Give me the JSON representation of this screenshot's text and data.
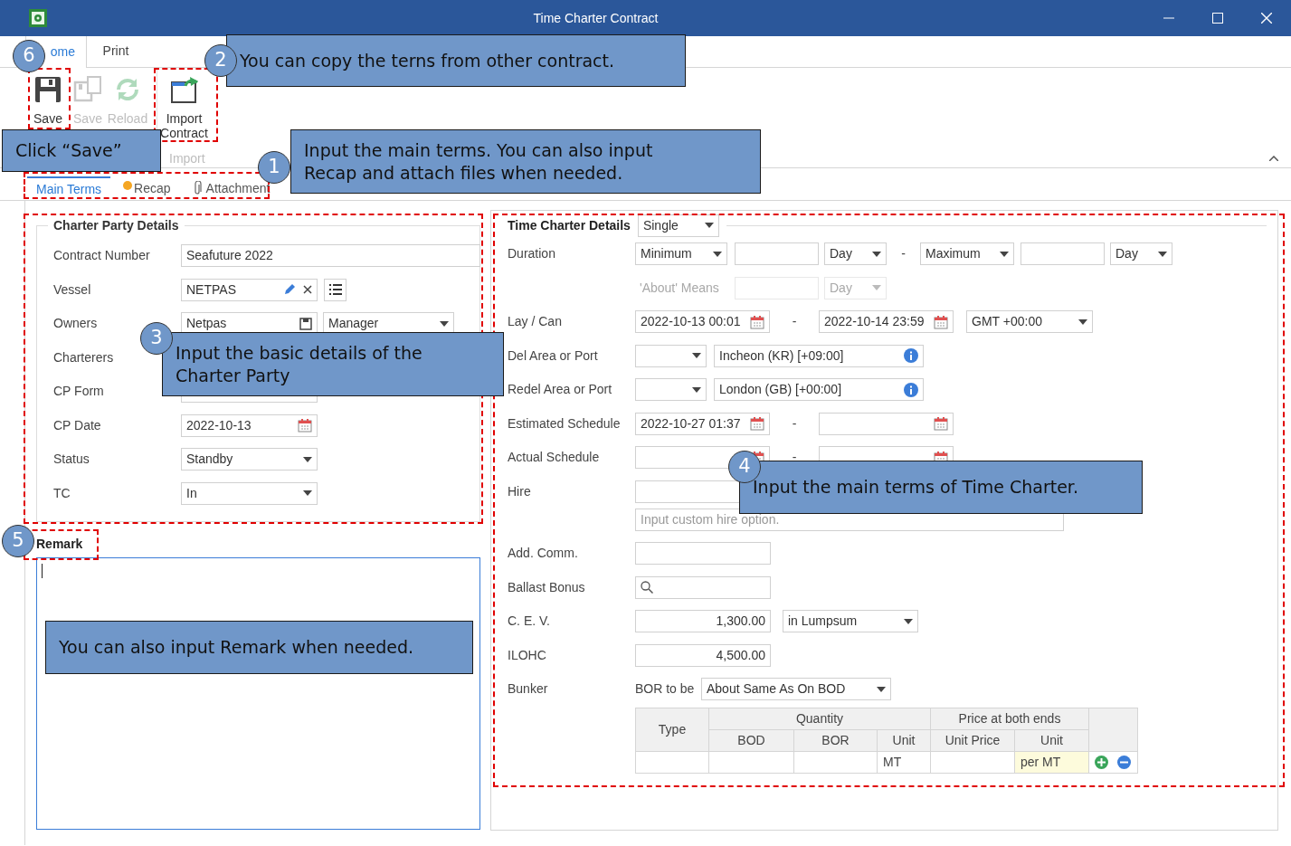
{
  "window": {
    "title": "Time Charter Contract"
  },
  "ribbon": {
    "tabs": [
      {
        "label": "ome",
        "selected": true
      },
      {
        "label": "Print",
        "selected": false
      }
    ],
    "buttons": [
      {
        "label": "Save",
        "kind": "save",
        "disabled": false
      },
      {
        "label": "Save",
        "kind": "save_all",
        "disabled": true
      },
      {
        "label": "Reload",
        "kind": "reload",
        "disabled": true
      },
      {
        "label": "Import Contract",
        "kind": "import",
        "disabled": false
      }
    ],
    "group_label": "Import"
  },
  "content_tabs": [
    {
      "label": "Main Terms",
      "kind": "plain",
      "selected": true
    },
    {
      "label": "Recap",
      "kind": "dot",
      "selected": false
    },
    {
      "label": "Attachment",
      "kind": "clip",
      "selected": false
    }
  ],
  "charter_party": {
    "title": "Charter Party Details",
    "rows": [
      {
        "label": "Contract Number",
        "kind": "wide_text",
        "value": "Seafuture 2022"
      },
      {
        "label": "Vessel",
        "kind": "vessel",
        "value": "NETPAS"
      },
      {
        "label": "Owners",
        "kind": "owners",
        "value": "Netpas",
        "role": "Manager"
      },
      {
        "label": "Charterers",
        "kind": "label_only"
      },
      {
        "label": "CP Form",
        "kind": "covered_text"
      },
      {
        "label": "CP Date",
        "kind": "date",
        "value": "2022-10-13"
      },
      {
        "label": "Status",
        "kind": "select",
        "value": "Standby"
      },
      {
        "label": "TC",
        "kind": "select",
        "value": "In"
      }
    ]
  },
  "remark": {
    "label": "Remark"
  },
  "time_charter": {
    "title": "Time Charter Details",
    "mode": "Single",
    "rows": [
      {
        "label": "Duration",
        "kind": "duration",
        "min_select": "Minimum",
        "min_unit": "Day",
        "separator": "-",
        "max_select": "Maximum",
        "max_unit": "Day"
      },
      {
        "label": "'About' Means",
        "kind": "about",
        "unit": "Day",
        "disabled": true
      },
      {
        "label": "Lay / Can",
        "kind": "date_range",
        "from": "2022-10-13 00:01",
        "separator": "-",
        "to": "2022-10-14 23:59",
        "timezone": "GMT +00:00"
      },
      {
        "label": "Del Area or Port",
        "kind": "port",
        "value": "Incheon (KR) [+09:00]"
      },
      {
        "label": "Redel Area or Port",
        "kind": "port",
        "value": "London (GB) [+00:00]"
      },
      {
        "label": "Estimated Schedule",
        "kind": "date_range",
        "from": "2022-10-27 01:37",
        "separator": "-"
      },
      {
        "label": "Actual Schedule",
        "kind": "date_range",
        "separator": "-"
      },
      {
        "label": "Hire",
        "kind": "hire",
        "placeholder": "Input custom hire option."
      },
      {
        "label": "Add. Comm.",
        "kind": "text"
      },
      {
        "label": "Ballast Bonus",
        "kind": "search"
      },
      {
        "label": "C. E. V.",
        "kind": "amount",
        "value": "1,300.00",
        "basis": "in Lumpsum"
      },
      {
        "label": "ILOHC",
        "kind": "amount",
        "value": "4,500.00"
      },
      {
        "label": "Bunker",
        "kind": "bunker",
        "sub_label": "BOR to be",
        "value": "About Same As On BOD"
      }
    ],
    "bunker_table": {
      "type_header": "Type",
      "groups": [
        "Quantity",
        "Price at both ends"
      ],
      "columns": [
        "BOD",
        "BOR",
        "Unit",
        "Unit Price",
        "Unit"
      ],
      "row": {
        "quantity_unit": "MT",
        "price_unit": "per MT"
      }
    }
  },
  "annotations": {
    "markers": [
      "6",
      "2",
      "1",
      "3",
      "4",
      "5"
    ],
    "callouts": [
      "You can copy the terns from other contract.",
      "Click “Save”",
      "Input the main terms. You can also input\nRecap and attach files when needed.",
      "Input the basic details of the\nCharter Party",
      "Input the main terms of Time Charter.",
      "You can also input Remark when needed."
    ]
  }
}
